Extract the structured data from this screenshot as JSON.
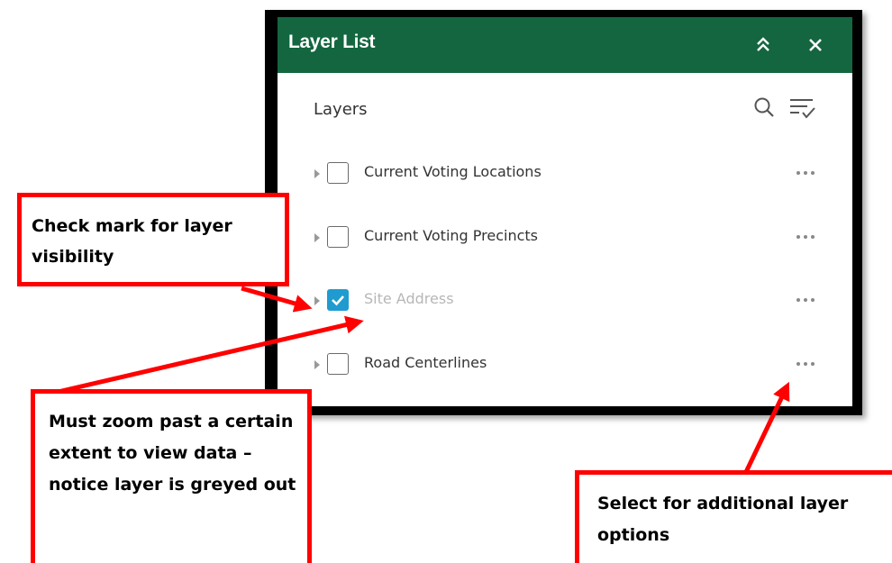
{
  "widget": {
    "title": "Layer List",
    "collapse_icon": "double-chevron-up-icon",
    "close_icon": "close-icon",
    "header_color": "#13663f"
  },
  "toolbar": {
    "heading": "Layers",
    "search_icon": "search-icon",
    "filter_icon": "filter-list-icon"
  },
  "layers": [
    {
      "label": "Current Voting Locations",
      "checked": false,
      "greyed_out": false
    },
    {
      "label": "Current Voting Precincts",
      "checked": false,
      "greyed_out": false
    },
    {
      "label": "Site Address",
      "checked": true,
      "greyed_out": true
    },
    {
      "label": "Road Centerlines",
      "checked": false,
      "greyed_out": false
    }
  ],
  "callouts": {
    "checkmark": "Check mark for layer visibility",
    "zoom": "Must zoom past a certain extent to view data – notice layer is greyed out",
    "options": "Select for additional layer options"
  },
  "colors": {
    "checkbox_checked": "#1f9bcf",
    "callout_border": "#ff0000"
  }
}
